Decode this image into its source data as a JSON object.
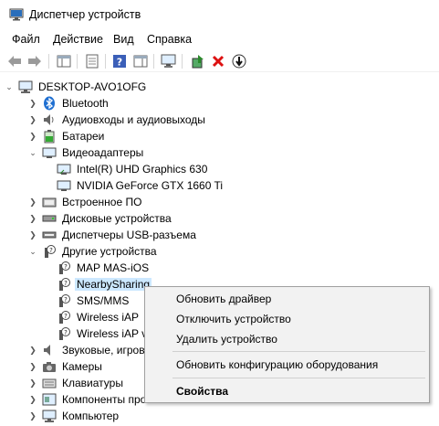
{
  "window": {
    "title": "Диспетчер устройств"
  },
  "menu": [
    "Файл",
    "Действие",
    "Вид",
    "Справка"
  ],
  "toolbar": {
    "icons": [
      "back-arrow-icon",
      "forward-arrow-icon",
      "console-tree-icon",
      "properties-icon",
      "help-icon",
      "action-pane-icon",
      "monitor-scan-icon",
      "update-driver-icon",
      "uninstall-x-icon",
      "disable-device-icon"
    ]
  },
  "tree": {
    "root": "DESKTOP-AVO1OFG",
    "items": [
      {
        "label": "Bluetooth",
        "icon": "bluetooth-icon",
        "expanded": false
      },
      {
        "label": "Аудиовходы и аудиовыходы",
        "icon": "speaker-icon",
        "expanded": false
      },
      {
        "label": "Батареи",
        "icon": "battery-icon",
        "expanded": false
      },
      {
        "label": "Видеоадаптеры",
        "icon": "display-adapter-icon",
        "expanded": true,
        "children": [
          "Intel(R) UHD Graphics 630",
          "NVIDIA GeForce GTX 1660 Ti"
        ]
      },
      {
        "label": "Встроенное ПО",
        "icon": "firmware-icon",
        "expanded": false
      },
      {
        "label": "Дисковые устройства",
        "icon": "disk-icon",
        "expanded": false
      },
      {
        "label": "Диспетчеры USB-разъема",
        "icon": "usb-icon",
        "expanded": false
      },
      {
        "label": "Другие устройства",
        "icon": "unknown-device-icon",
        "expanded": true,
        "children": [
          "MAP MAS-iOS",
          "NearbySharing",
          "SMS/MMS",
          "Wireless iAP",
          "Wireless iAP v"
        ]
      },
      {
        "label": "Звуковые, игров",
        "icon": "sound-icon",
        "expanded": false
      },
      {
        "label": "Камеры",
        "icon": "camera-icon",
        "expanded": false
      },
      {
        "label": "Клавиатуры",
        "icon": "keyboard-icon",
        "expanded": false
      },
      {
        "label": "Компоненты про",
        "icon": "software-component-icon",
        "expanded": false
      },
      {
        "label": "Компьютер",
        "icon": "computer-icon",
        "expanded": false
      }
    ],
    "selected": "NearbySharing"
  },
  "context_menu": {
    "items": [
      "Обновить драйвер",
      "Отключить устройство",
      "Удалить устройство",
      "Обновить конфигурацию оборудования",
      "Свойства"
    ]
  }
}
